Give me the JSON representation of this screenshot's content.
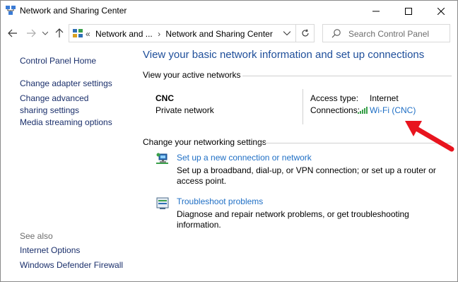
{
  "window": {
    "title": "Network and Sharing Center"
  },
  "address_bar": {
    "overflow": "«",
    "crumb_1": "Network and ...",
    "crumb_sep": "›",
    "crumb_2": "Network and Sharing Center",
    "search_placeholder": "Search Control Panel"
  },
  "sidebar": {
    "items": [
      {
        "label": "Control Panel Home"
      },
      {
        "label": "Change adapter settings"
      },
      {
        "label": "Change advanced sharing settings"
      },
      {
        "label": "Media streaming options"
      }
    ],
    "see_also_label": "See also",
    "see_also": [
      {
        "label": "Internet Options"
      },
      {
        "label": "Windows Defender Firewall"
      }
    ]
  },
  "main": {
    "title": "View your basic network information and set up connections",
    "active_networks_heading": "View your active networks",
    "network": {
      "name": "CNC",
      "type": "Private network",
      "access_type_label": "Access type:",
      "access_type_value": "Internet",
      "connections_label": "Connections:",
      "connection_link": "Wi-Fi (CNC)"
    },
    "change_heading": "Change your networking settings",
    "tasks": [
      {
        "link": "Set up a new connection or network",
        "desc": "Set up a broadband, dial-up, or VPN connection; or set up a router or access point.",
        "icon": "network-setup-icon"
      },
      {
        "link": "Troubleshoot problems",
        "desc": "Diagnose and repair network problems, or get troubleshooting information.",
        "icon": "troubleshoot-icon"
      }
    ]
  },
  "colors": {
    "link_blue": "#1f6fc5",
    "title_blue": "#1e4e9a",
    "sidebar_link": "#1a2f6b",
    "annotation_red": "#e8141e"
  }
}
